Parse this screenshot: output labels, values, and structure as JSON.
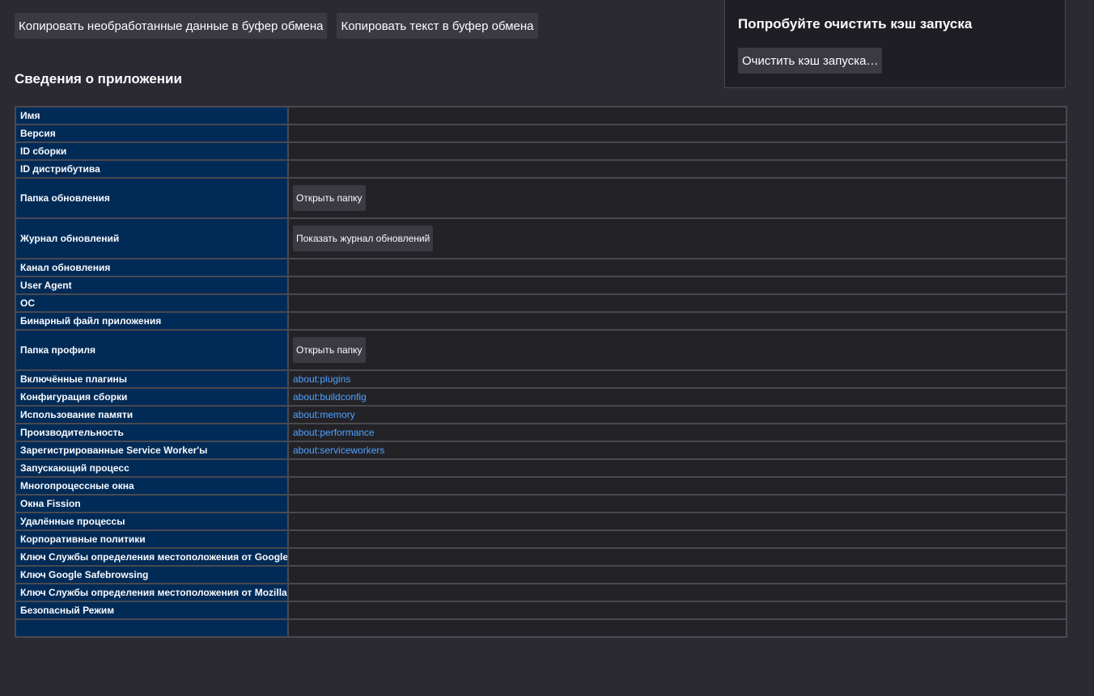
{
  "toolbar": {
    "copy_raw_label": "Копировать необработанные данные в буфер обмена",
    "copy_text_label": "Копировать текст в буфер обмена"
  },
  "cache": {
    "title": "Попробуйте очистить кэш запуска",
    "button_label": "Очистить кэш запуска…"
  },
  "app_info": {
    "title": "Сведения о приложении",
    "rows": [
      {
        "key": "Имя",
        "value": ""
      },
      {
        "key": "Версия",
        "value": ""
      },
      {
        "key": "ID сборки",
        "value": ""
      },
      {
        "key": "ID дистрибутива",
        "value": ""
      },
      {
        "key": "Папка обновления",
        "button": "Открыть папку"
      },
      {
        "key": "Журнал обновлений",
        "button": "Показать журнал обновлений"
      },
      {
        "key": "Канал обновления",
        "value": ""
      },
      {
        "key": "User Agent",
        "value": ""
      },
      {
        "key": "ОС",
        "value": ""
      },
      {
        "key": "Бинарный файл приложения",
        "value": ""
      },
      {
        "key": "Папка профиля",
        "button": "Открыть папку"
      },
      {
        "key": "Включённые плагины",
        "link": "about:plugins"
      },
      {
        "key": "Конфигурация сборки",
        "link": "about:buildconfig"
      },
      {
        "key": "Использование памяти",
        "link": "about:memory"
      },
      {
        "key": "Производительность",
        "link": "about:performance"
      },
      {
        "key": "Зарегистрированные Service Worker'ы",
        "link": "about:serviceworkers"
      },
      {
        "key": "Запускающий процесс",
        "value": ""
      },
      {
        "key": "Многопроцессные окна",
        "value": ""
      },
      {
        "key": "Окна Fission",
        "value": ""
      },
      {
        "key": "Удалённые процессы",
        "value": ""
      },
      {
        "key": "Корпоративные политики",
        "value": ""
      },
      {
        "key": "Ключ Службы определения местоположения от Google",
        "value": ""
      },
      {
        "key": "Ключ Google Safebrowsing",
        "value": ""
      },
      {
        "key": "Ключ Службы определения местоположения от Mozilla",
        "value": ""
      },
      {
        "key": "Безопасный Режим",
        "value": ""
      },
      {
        "key": "",
        "value": ""
      }
    ]
  }
}
